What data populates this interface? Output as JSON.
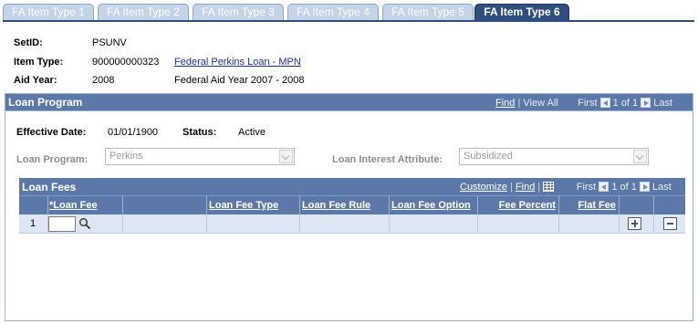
{
  "tabs": [
    {
      "label": "FA Item Type 1",
      "active": false
    },
    {
      "label": "FA Item Type 2",
      "active": false
    },
    {
      "label": "FA Item Type 3",
      "active": false
    },
    {
      "label": "FA Item Type 4",
      "active": false
    },
    {
      "label": "FA Item Type 5",
      "active": false
    },
    {
      "label": "FA Item Type 6",
      "active": true
    }
  ],
  "header": {
    "setid_label": "SetID:",
    "setid_value": "PSUNV",
    "item_type_label": "Item Type:",
    "item_type_value": "900000000323",
    "item_type_link": "Federal Perkins Loan - MPN",
    "aid_year_label": "Aid Year:",
    "aid_year_value": "2008",
    "aid_year_desc": "Federal Aid Year 2007 - 2008"
  },
  "loan_program": {
    "title": "Loan Program",
    "nav": {
      "find": "Find",
      "view_all": "View All",
      "first": "First",
      "count": "1 of 1",
      "last": "Last"
    },
    "effective_date_label": "Effective Date:",
    "effective_date_value": "01/01/1900",
    "status_label": "Status:",
    "status_value": "Active",
    "program_label": "Loan Program:",
    "program_value": "Perkins",
    "interest_label": "Loan Interest Attribute:",
    "interest_value": "Subsidized"
  },
  "loan_fees": {
    "title": "Loan Fees",
    "nav": {
      "customize": "Customize",
      "find": "Find",
      "first": "First",
      "count": "1 of 1",
      "last": "Last"
    },
    "columns": [
      "*Loan Fee",
      "Loan Fee Type",
      "Loan Fee Rule",
      "Loan Fee Option",
      "Fee Percent",
      "Flat Fee"
    ],
    "rows": [
      {
        "num": "1",
        "loan_fee": ""
      }
    ]
  },
  "colors": {
    "tab_active": "#2f4e7f",
    "tab_inactive": "#c3d3e8",
    "header_blue": "#5b78a9",
    "row_bg": "#dde6f3",
    "link": "#1a2fa6"
  },
  "icons": [
    "search-icon",
    "add-row-icon",
    "delete-row-icon",
    "grid-download-icon",
    "first-arrow-icon",
    "last-arrow-icon"
  ]
}
